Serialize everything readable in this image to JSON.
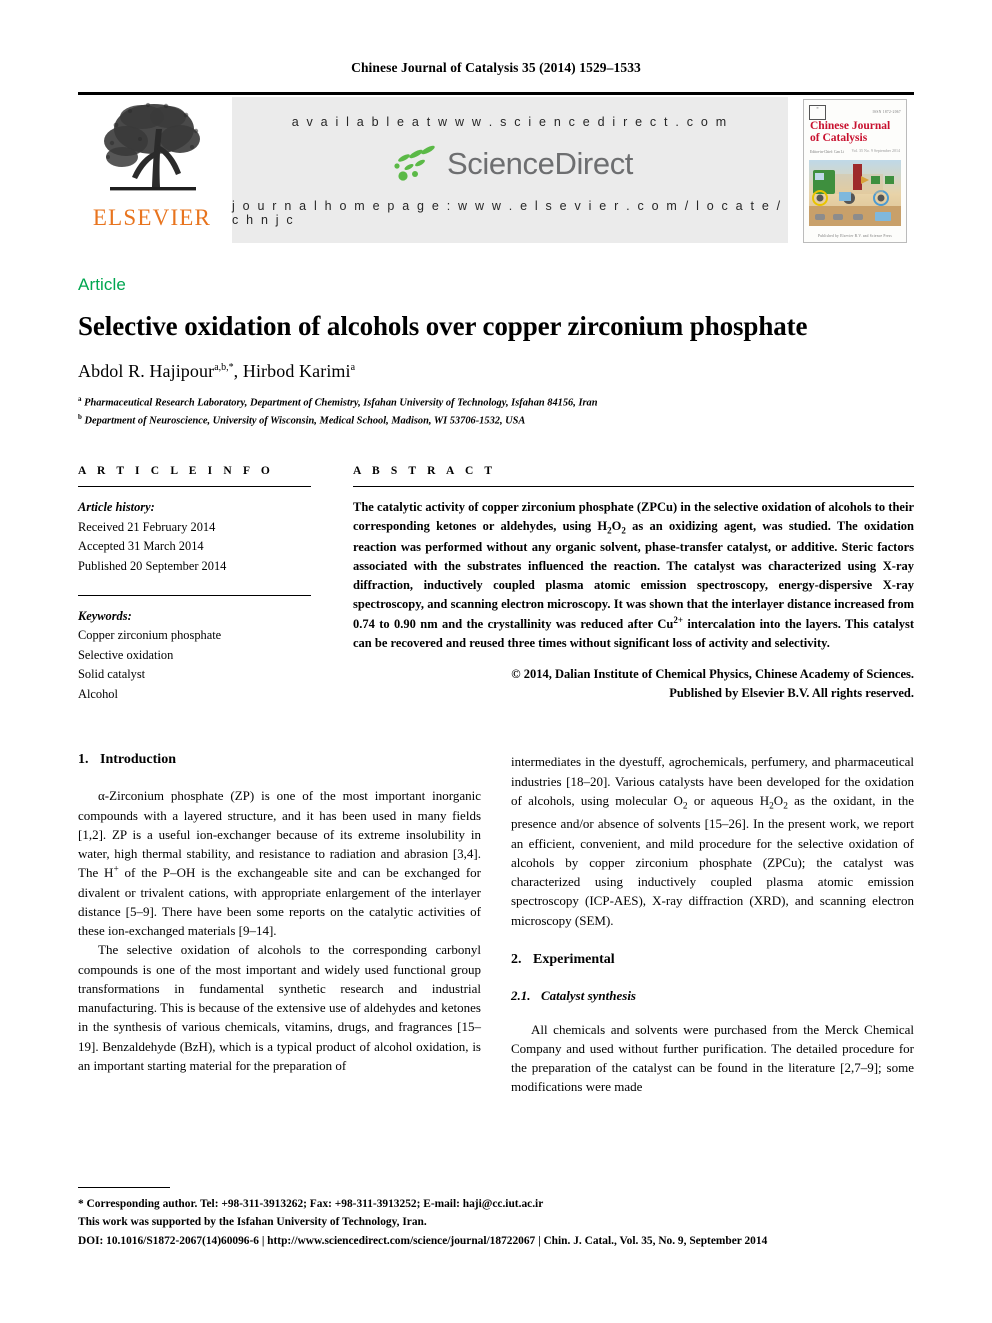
{
  "running_head": "Chinese Journal of Catalysis 35 (2014) 1529–1533",
  "masthead": {
    "publisher_name": "ELSEVIER",
    "available_at": "a v a i l a b l e   a t   w w w . s c i e n c e d i r e c t . c o m",
    "sciencedirect_wordmark": "ScienceDirect",
    "journal_homepage": "j o u r n a l   h o m e p a g e :   w w w . e l s e v i e r . c o m / l o c a t e / c h n j c",
    "cover": {
      "title_line1": "Chinese Journal",
      "title_line2": "of Catalysis",
      "issn_note": "ISSN 1872-2067",
      "volume_note": "Vol. 35 No. 9 September 2014",
      "editor_note": "Editor-in-Chief: Can Li",
      "footer_note": "Published by Elsevier B.V. and Science Press"
    }
  },
  "article": {
    "type_label": "Article",
    "title": "Selective oxidation of alcohols over copper zirconium phosphate",
    "authors": [
      {
        "name": "Abdol R. Hajipour",
        "marks": "a,b,*"
      },
      {
        "name": "Hirbod Karimi",
        "marks": "a"
      }
    ],
    "affiliations": [
      {
        "mark": "a",
        "text": "Pharmaceutical Research Laboratory, Department of Chemistry, Isfahan University of Technology, Isfahan 84156, Iran"
      },
      {
        "mark": "b",
        "text": "Department of Neuroscience, University of Wisconsin, Medical School, Madison, WI 53706-1532, USA"
      }
    ]
  },
  "article_info": {
    "caption": "A R T I C L E   I N F O",
    "history_label": "Article history:",
    "history": [
      "Received 21 February 2014",
      "Accepted 31 March 2014",
      "Published 20 September 2014"
    ],
    "keywords_label": "Keywords:",
    "keywords": [
      "Copper zirconium phosphate",
      "Selective oxidation",
      "Solid catalyst",
      "Alcohol"
    ]
  },
  "abstract": {
    "caption": "A B S T R A C T",
    "paragraph_html": "The catalytic activity of copper zirconium phosphate (ZPCu) in the selective oxidation of alcohols to their corresponding ketones or aldehydes, using H<sub>2</sub>O<sub>2</sub> as an oxidizing agent, was studied. The oxidation reaction was performed without any organic solvent, phase-transfer catalyst, or additive. Steric factors associated with the substrates influenced the reaction. The catalyst was characterized using X-ray diffraction, inductively coupled plasma atomic emission spectroscopy, energy-dispersive X-ray spectroscopy, and scanning electron microscopy. It was shown that the interlayer distance increased from 0.74 to 0.90 nm and the crystallinity was reduced after Cu<sup>2+</sup> intercalation into the layers. This catalyst can be recovered and reused three times without significant loss of activity and selectivity.",
    "copyright_line1": "© 2014, Dalian Institute of Chemical Physics, Chinese Academy of Sciences.",
    "copyright_line2": "Published by Elsevier B.V. All rights reserved."
  },
  "sections": {
    "introduction": {
      "number": "1.",
      "heading": "Introduction",
      "paragraph1_html": "α-Zirconium phosphate (ZP) is one of the most important inorganic compounds with a layered structure, and it has been used in many fields [1,2]. ZP is a useful ion-exchanger because of its extreme insolubility in water, high thermal stability, and resistance to radiation and abrasion [3,4]. The H<sup>+</sup> of the P–OH is the exchangeable site and can be exchanged for divalent or trivalent cations, with appropriate enlargement of the interlayer distance [5–9]. There have been some reports on the catalytic activities of these ion-exchanged materials [9–14].",
      "paragraph2_html": "The selective oxidation of alcohols to the corresponding carbonyl compounds is one of the most important and widely used functional group transformations in fundamental synthetic research and industrial manufacturing. This is because of the extensive use of aldehydes and ketones in the synthesis of various chemicals, vitamins, drugs, and fragrances [15–19]. Benzaldehyde (BzH), which is a typical product of alcohol oxidation, is an important starting material for the preparation of",
      "paragraph2_cont_html": "intermediates in the dyestuff, agrochemicals, perfumery, and pharmaceutical industries [18–20]. Various catalysts have been developed for the oxidation of alcohols, using molecular O<sub>2</sub> or aqueous H<sub>2</sub>O<sub>2</sub> as the oxidant, in the presence and/or absence of solvents [15–26]. In the present work, we report an efficient, convenient, and mild procedure for the selective oxidation of alcohols by copper zirconium phosphate (ZPCu); the catalyst was characterized using inductively coupled plasma atomic emission spectroscopy (ICP-AES), X-ray diffraction (XRD), and scanning electron microscopy (SEM)."
    },
    "experimental": {
      "number": "2.",
      "heading": "Experimental",
      "sub_number": "2.1.",
      "sub_heading": "Catalyst synthesis",
      "paragraph1_html": "All chemicals and solvents were purchased from the Merck Chemical Company and used without further purification. The detailed procedure for the preparation of the catalyst can be found in the literature [2,7–9]; some modifications were made"
    }
  },
  "footnotes": {
    "corresponding": "* Corresponding author. Tel: +98-311-3913262; Fax: +98-311-3913252; E-mail: haji@cc.iut.ac.ir",
    "funding": "This work was supported by the Isfahan University of Technology, Iran.",
    "doi_line": "DOI: 10.1016/S1872-2067(14)60096-6 | http://www.sciencedirect.com/science/journal/18722067 | Chin. J. Catal., Vol. 35, No. 9, September 2014"
  },
  "colors": {
    "article_type_green": "#00A650",
    "elsevier_orange": "#E8741E",
    "sciencedirect_gray": "#6D6E70",
    "sciencedirect_green": "#5BB947",
    "cover_red": "#C8102E",
    "banner_gray": "#EBEBEB"
  }
}
